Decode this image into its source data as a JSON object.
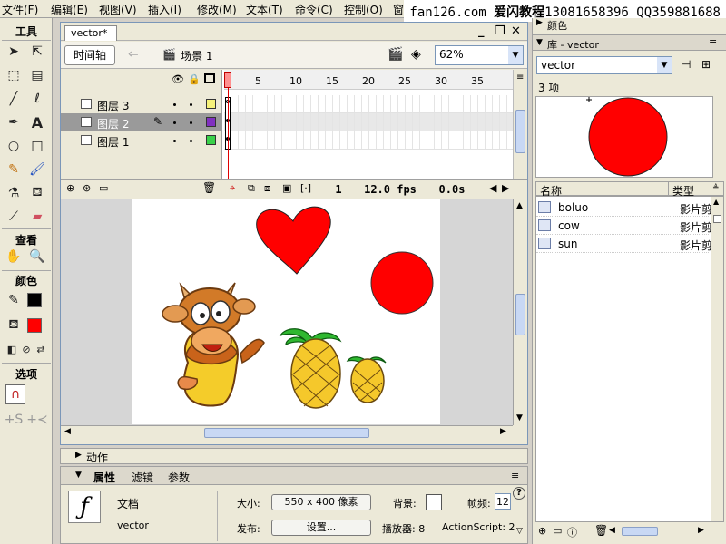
{
  "menu": [
    "文件(F)",
    "编辑(E)",
    "视图(V)",
    "插入(I)",
    "修改(M)",
    "文本(T)",
    "命令(C)",
    "控制(O)",
    "窗"
  ],
  "watermark": {
    "site": "fan126.com",
    "brand": "爱闪教程",
    "contact": "13081658396 QQ359881688"
  },
  "tools": {
    "title": "工具",
    "view": "查看",
    "colors": "颜色",
    "options": "选项"
  },
  "document": {
    "tab": "vector*",
    "timeline_button": "时间轴",
    "scene": "场景 1",
    "zoom": "62%"
  },
  "timeline": {
    "frame_numbers": [
      "1",
      "5",
      "10",
      "15",
      "20",
      "25",
      "30",
      "35"
    ],
    "layers": [
      {
        "name": "图层 3",
        "color": "#f6f27a"
      },
      {
        "name": "图层 2",
        "color": "#8030c0"
      },
      {
        "name": "图层 1",
        "color": "#3ad14a"
      }
    ],
    "current_frame": "1",
    "fps": "12.0 fps",
    "time": "0.0s"
  },
  "actions_panel": {
    "label": "动作"
  },
  "properties": {
    "tabs": [
      "属性",
      "滤镜",
      "参数"
    ],
    "doc_label": "文档",
    "doc_name": "vector",
    "size_label": "大小:",
    "size_value": "550 x 400 像素",
    "bg_label": "背景:",
    "fps_label": "帧频:",
    "fps_value": "12",
    "publish_label": "发布:",
    "settings_button": "设置...",
    "player_label": "播放器: 8",
    "actionscript_label": "ActionScript: 2"
  },
  "right_panel": {
    "color_panel": "颜色",
    "library_title": "库 - vector",
    "library_doc": "vector",
    "item_count": "3 项",
    "col_name": "名称",
    "col_type": "类型",
    "items": [
      {
        "name": "boluo",
        "type": "影片剪"
      },
      {
        "name": "cow",
        "type": "影片剪"
      },
      {
        "name": "sun",
        "type": "影片剪"
      }
    ]
  },
  "colors": {
    "stroke": "#000000",
    "fill": "#ff0000",
    "window_border": "#7a96b8"
  }
}
